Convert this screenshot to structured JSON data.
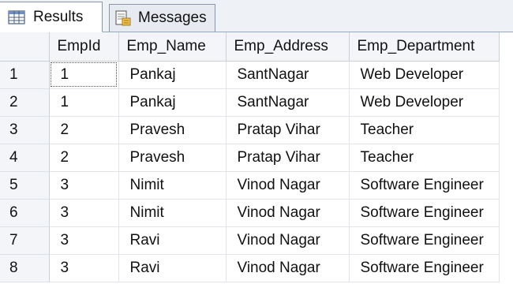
{
  "tabs": {
    "results_label": "Results",
    "messages_label": "Messages"
  },
  "grid": {
    "columns": [
      "EmpId",
      "Emp_Name",
      "Emp_Address",
      "Emp_Department"
    ],
    "rows": [
      {
        "num": "1",
        "cells": [
          "1",
          "Pankaj",
          "SantNagar",
          "Web Developer"
        ]
      },
      {
        "num": "2",
        "cells": [
          "1",
          "Pankaj",
          "SantNagar",
          "Web Developer"
        ]
      },
      {
        "num": "3",
        "cells": [
          "2",
          "Pravesh",
          "Pratap Vihar",
          "Teacher"
        ]
      },
      {
        "num": "4",
        "cells": [
          "2",
          "Pravesh",
          "Pratap Vihar",
          "Teacher"
        ]
      },
      {
        "num": "5",
        "cells": [
          "3",
          "Nimit",
          "Vinod Nagar",
          "Software Engineer"
        ]
      },
      {
        "num": "6",
        "cells": [
          "3",
          "Nimit",
          "Vinod Nagar",
          "Software Engineer"
        ]
      },
      {
        "num": "7",
        "cells": [
          "3",
          "Ravi",
          "Vinod Nagar",
          "Software Engineer"
        ]
      },
      {
        "num": "8",
        "cells": [
          "3",
          "Ravi",
          "Vinod Nagar",
          "Software Engineer"
        ]
      }
    ]
  }
}
